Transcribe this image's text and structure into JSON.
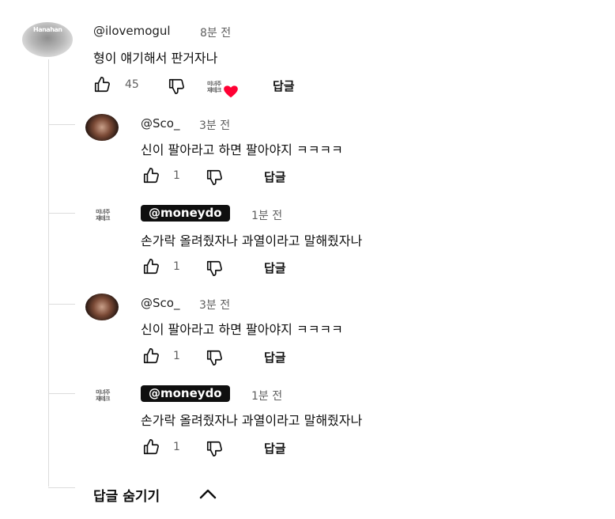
{
  "top_comment": {
    "author": "@ilovemogul",
    "time": "8분 전",
    "text": "형이 얘기해서 판거자나",
    "likes": "45",
    "reply_label": "답글",
    "creator_logo_text": "미녀주\n재테크",
    "avatar_label": "Hanahan"
  },
  "replies": [
    {
      "author": "@Sco_",
      "time": "3분 전",
      "text": "신이 팔아라고 하면 팔아야지 ㅋㅋㅋㅋ",
      "likes": "1",
      "reply_label": "답글",
      "is_creator": false
    },
    {
      "author": "@moneydo",
      "time": "1분 전",
      "text": "손가락 올려줬자나 과열이라고 말해줬자나",
      "likes": "1",
      "reply_label": "답글",
      "is_creator": true,
      "logo_text": "미녀주\n재테크"
    },
    {
      "author": "@Sco_",
      "time": "3분 전",
      "text": "신이 팔아라고 하면 팔아야지 ㅋㅋㅋㅋ",
      "likes": "1",
      "reply_label": "답글",
      "is_creator": false
    },
    {
      "author": "@moneydo",
      "time": "1분 전",
      "text": "손가락 올려줬자나 과열이라고 말해줬자나",
      "likes": "1",
      "reply_label": "답글",
      "is_creator": true,
      "logo_text": "미녀주\n재테크"
    }
  ],
  "hide_replies_label": "답글 숨기기",
  "icons": {
    "like": "thumbs-up-icon",
    "dislike": "thumbs-down-icon",
    "heart": "heart-icon",
    "collapse": "chevron-up-icon"
  },
  "colors": {
    "heart": "#ff0033",
    "badge_bg": "#0f0f0f",
    "meta": "#606060",
    "thread_line": "#dcdcdc"
  }
}
